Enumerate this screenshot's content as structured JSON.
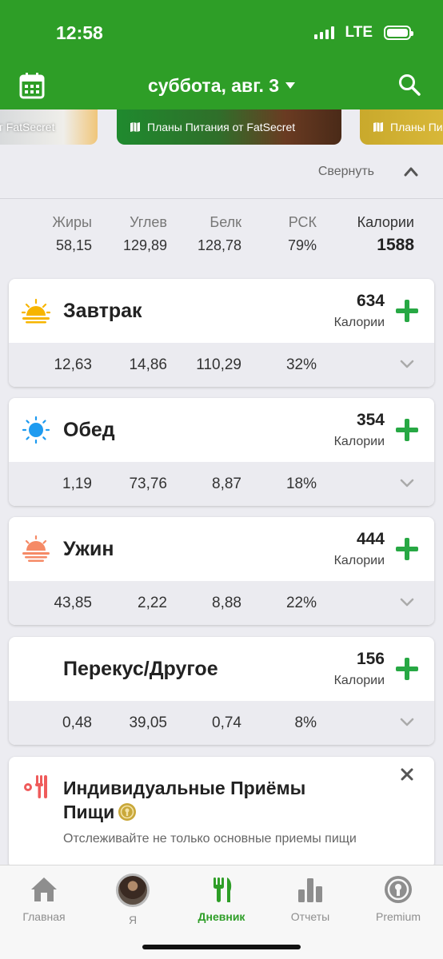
{
  "status": {
    "time": "12:58",
    "network": "LTE"
  },
  "header": {
    "date": "суббота, авг. 3"
  },
  "banners": [
    {
      "text": "от FatSecret"
    },
    {
      "text": "Планы Питания от FatSecret"
    },
    {
      "text": "Планы Пи"
    }
  ],
  "collapse": {
    "label": "Свернуть"
  },
  "totals": {
    "columns": [
      {
        "label": "Жиры",
        "value": "58,15"
      },
      {
        "label": "Углев",
        "value": "129,89"
      },
      {
        "label": "Белк",
        "value": "128,78"
      },
      {
        "label": "РСК",
        "value": "79%"
      },
      {
        "label": "Калории",
        "value": "1588"
      }
    ]
  },
  "meals": [
    {
      "name": "Завтрак",
      "calories": "634",
      "calories_label": "Калории",
      "fat": "12,63",
      "carbs": "14,86",
      "protein": "110,29",
      "rdi": "32%",
      "icon": "sunrise-icon"
    },
    {
      "name": "Обед",
      "calories": "354",
      "calories_label": "Калории",
      "fat": "1,19",
      "carbs": "73,76",
      "protein": "8,87",
      "rdi": "18%",
      "icon": "sun-icon"
    },
    {
      "name": "Ужин",
      "calories": "444",
      "calories_label": "Калории",
      "fat": "43,85",
      "carbs": "2,22",
      "protein": "8,88",
      "rdi": "22%",
      "icon": "sunset-icon"
    },
    {
      "name": "Перекус/Другое",
      "calories": "156",
      "calories_label": "Калории",
      "fat": "0,48",
      "carbs": "39,05",
      "protein": "0,74",
      "rdi": "8%",
      "icon": "moon-icon"
    }
  ],
  "promo": {
    "title": "Индивидуальные Приёмы Пищи",
    "subtitle": "Отслеживайте не только основные приемы пищи"
  },
  "tabs": [
    {
      "label": "Главная",
      "icon": "home-icon"
    },
    {
      "label": "Я",
      "icon": "avatar"
    },
    {
      "label": "Дневник",
      "icon": "fork-knife-icon"
    },
    {
      "label": "Отчеты",
      "icon": "bar-chart-icon"
    },
    {
      "label": "Premium",
      "icon": "premium-badge-icon"
    }
  ],
  "colors": {
    "brand": "#2e9e27",
    "add": "#27a844",
    "snack": "#7b4fc7"
  }
}
